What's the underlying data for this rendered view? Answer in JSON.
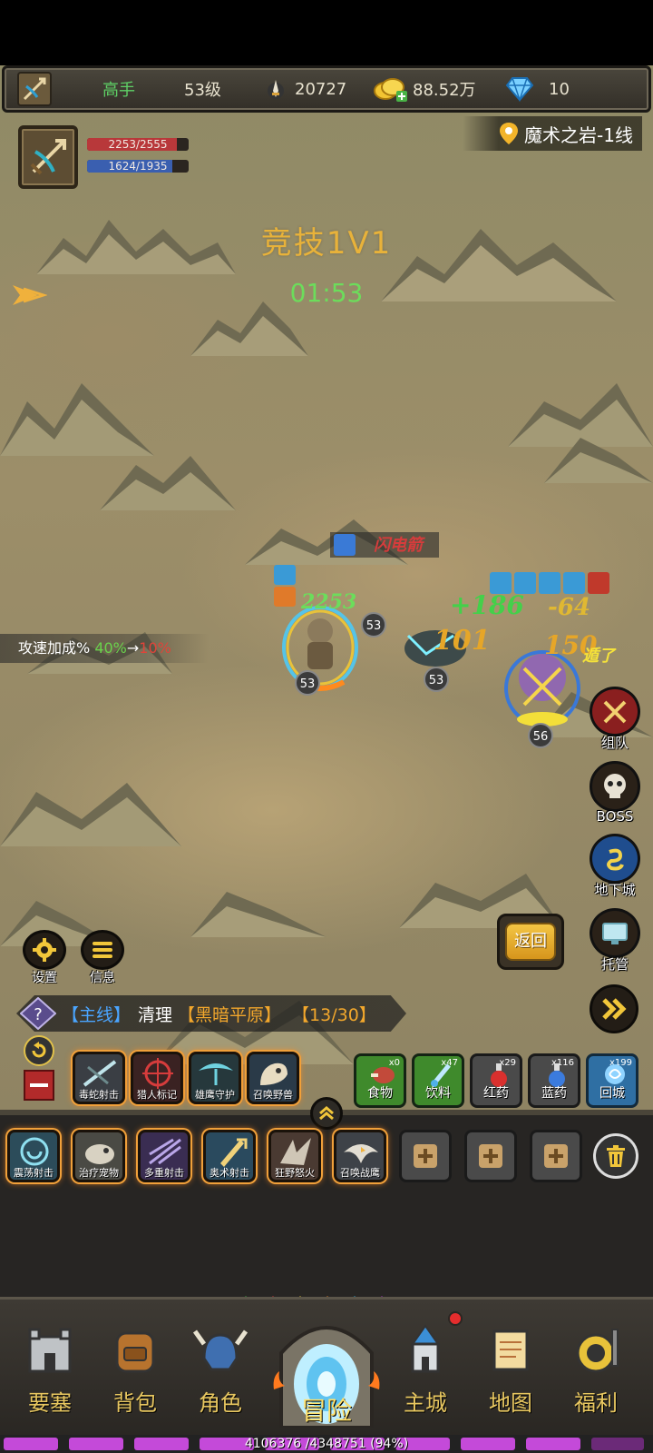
{
  "topbar": {
    "rank": "高手",
    "level": "53级",
    "power": "20727",
    "gold": "88.52万",
    "gems": "10"
  },
  "player": {
    "hp_text": "2253/2555",
    "hp_ratio": 0.882,
    "mp_text": "1624/1935",
    "mp_ratio": 0.839
  },
  "location": "魔术之岩-1线",
  "arena": {
    "title": "竞技1V1",
    "timer": "01:53"
  },
  "buff": {
    "label": "攻速加成%",
    "from": "40%",
    "arrow": "→",
    "to": "10%"
  },
  "battle": {
    "floating_texts": [
      "闪电箭",
      "+186",
      "-64",
      "101",
      "150",
      "2253",
      "遁了"
    ],
    "levels": [
      "53",
      "53",
      "53",
      "56"
    ]
  },
  "side_buttons": {
    "team": "组队",
    "boss": "BOSS",
    "dungeon": "地下城",
    "auto": "托管"
  },
  "return_label": "返回",
  "settings_label": "设置",
  "info_label": "信息",
  "quest": {
    "tag": "【主线】",
    "action": "清理",
    "place": "【黑暗平原】",
    "progress": "【13/30】"
  },
  "skills_row1": [
    {
      "label": "毒蛇射击"
    },
    {
      "label": "猎人标记"
    },
    {
      "label": "雄鹰守护"
    },
    {
      "label": "召唤野兽"
    }
  ],
  "items": [
    {
      "label": "食物",
      "count": "x0"
    },
    {
      "label": "饮料",
      "count": "x47"
    },
    {
      "label": "红药",
      "count": "x29"
    },
    {
      "label": "蓝药",
      "count": "x116"
    },
    {
      "label": "回城",
      "count": "x199"
    }
  ],
  "skills_row2": [
    {
      "label": "震荡射击"
    },
    {
      "label": "治疗宠物"
    },
    {
      "label": "多重射击"
    },
    {
      "label": "奥术射击"
    },
    {
      "label": "狂野怒火"
    },
    {
      "label": "召唤战鹰"
    }
  ],
  "nav": [
    {
      "label": "要塞"
    },
    {
      "label": "背包"
    },
    {
      "label": "角色"
    },
    {
      "label": "冒险"
    },
    {
      "label": "主城"
    },
    {
      "label": "地图"
    },
    {
      "label": "福利"
    }
  ],
  "xp": {
    "text": "4106376 /4348751 (94%)",
    "ratio": 0.94
  },
  "colors": {
    "title": "#e8b23a",
    "timer": "#6cdd5b",
    "quest_tag": "#4aa5ff",
    "quest_place": "#f2a72c",
    "xp": "#c44ad9"
  }
}
